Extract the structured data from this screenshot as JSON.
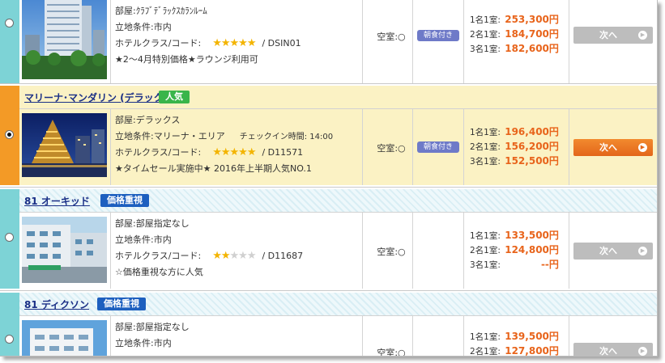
{
  "hotels": [
    {
      "room": "部屋:ｸﾗﾌﾞﾃﾞﾗｯｸｽｶﾗﾝﾙｰﾑ",
      "location": "立地条件:市内",
      "class_label": "ホテルクラス/コード:",
      "stars": 5,
      "code": "/ DSIN01",
      "note": "★2〜4月特別価格★ラウンジ利用可",
      "vacancy": "空室:○",
      "meal": "朝食付き",
      "prices": [
        {
          "label": "1名1室:",
          "value": "253,300円"
        },
        {
          "label": "2名1室:",
          "value": "184,700円"
        },
        {
          "label": "3名1室:",
          "value": "182,600円"
        }
      ],
      "next_label": "次へ"
    },
    {
      "name": "マリーナ･マンダリン (デラックス)",
      "tag": "人気",
      "room": "部屋:デラックス",
      "location": "立地条件:マリーナ・エリア",
      "checkin": "チェックイン時間: 14:00",
      "class_label": "ホテルクラス/コード:",
      "stars": 5,
      "code": "/ D11571",
      "note": "★タイムセール実施中★ 2016年上半期人気NO.1",
      "vacancy": "空室:○",
      "meal": "朝食付き",
      "prices": [
        {
          "label": "1名1室:",
          "value": "196,400円"
        },
        {
          "label": "2名1室:",
          "value": "156,200円"
        },
        {
          "label": "3名1室:",
          "value": "152,500円"
        }
      ],
      "next_label": "次へ"
    },
    {
      "name": "81 オーキッド",
      "tag": "価格重視",
      "room": "部屋:部屋指定なし",
      "location": "立地条件:市内",
      "class_label": "ホテルクラス/コード:",
      "stars": 2,
      "code": "/ D11687",
      "note": "☆価格重視な方に人気",
      "vacancy": "空室:○",
      "prices": [
        {
          "label": "1名1室:",
          "value": "133,500円"
        },
        {
          "label": "2名1室:",
          "value": "124,800円"
        },
        {
          "label": "3名1室:",
          "value": "--円"
        }
      ],
      "next_label": "次へ"
    },
    {
      "name": "81 ディクソン",
      "tag": "価格重視",
      "room": "部屋:部屋指定なし",
      "location": "立地条件:市内",
      "vacancy": "空室:○",
      "prices": [
        {
          "label": "1名1室:",
          "value": "139,500円"
        },
        {
          "label": "2名1室:",
          "value": "127,800円"
        }
      ],
      "next_label": "次へ"
    }
  ],
  "star_glyph": "★",
  "arrow_glyph": "▶",
  "colors": {
    "teal_stripe": "#7dd3d6",
    "orange_stripe": "#f39a26",
    "selected_bg": "#fbf2c4",
    "price_orange": "#e8641b",
    "tag_green": "#39b54a",
    "tag_blue": "#1d5fbf",
    "meal_badge": "#6e7ac8"
  }
}
